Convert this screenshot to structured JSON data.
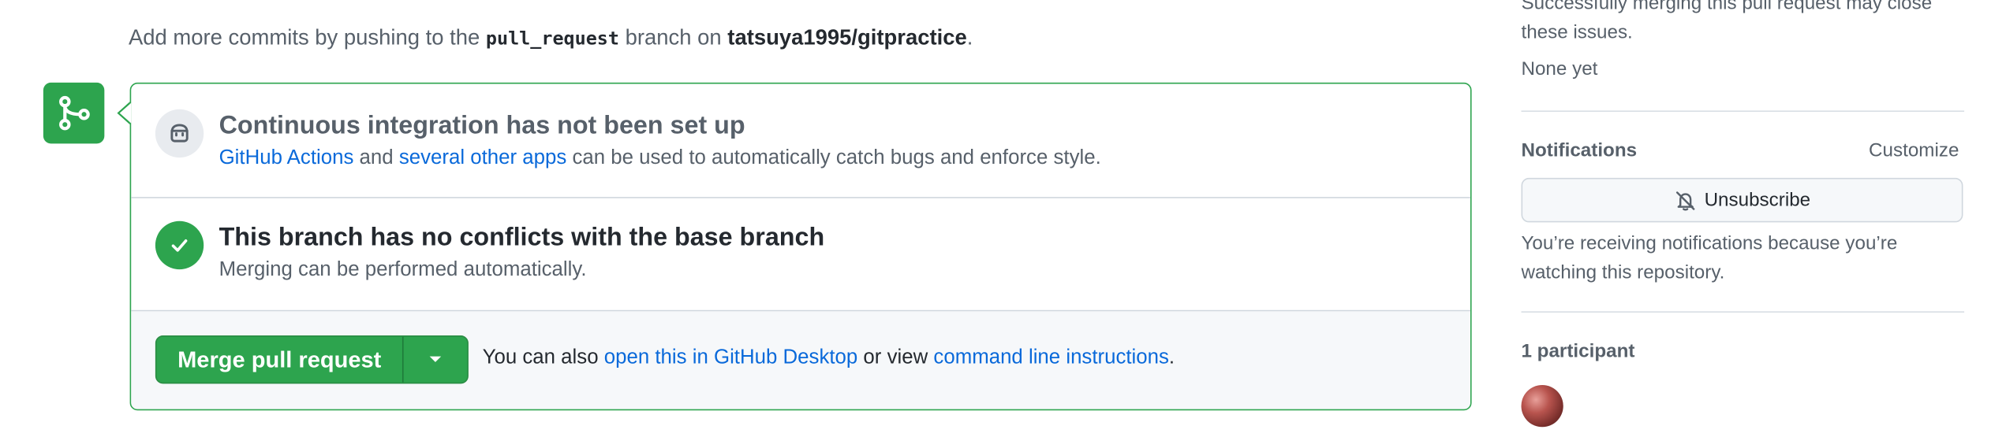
{
  "hint": {
    "prefix": "Add more commits by pushing to the",
    "branch": "pull_request",
    "middle": "branch on",
    "repo": "tatsuya1995/gitpractice",
    "suffix": "."
  },
  "ci": {
    "title": "Continuous integration has not been set up",
    "link1": "GitHub Actions",
    "and_text": "and",
    "link2": "several other apps",
    "rest": "can be used to automatically catch bugs and enforce style."
  },
  "conflicts": {
    "title": "This branch has no conflicts with the base branch",
    "desc": "Merging can be performed automatically."
  },
  "merge": {
    "button_label": "Merge pull request",
    "also_prefix": "You can also",
    "desktop_link": "open this in GitHub Desktop",
    "or_view": "or view",
    "cli_link": "command line instructions",
    "suffix": "."
  },
  "sidebar": {
    "issues_note": "Successfully merging this pull request may close these issues.",
    "issues_value": "None yet",
    "notifications_heading": "Notifications",
    "customize_label": "Customize",
    "unsubscribe_label": "Unsubscribe",
    "notifications_note": "You’re receiving notifications because you’re watching this repository.",
    "participants_heading": "1 participant"
  },
  "colors": {
    "success": "#2da44e",
    "link": "#0969da",
    "muted": "#57606a"
  }
}
